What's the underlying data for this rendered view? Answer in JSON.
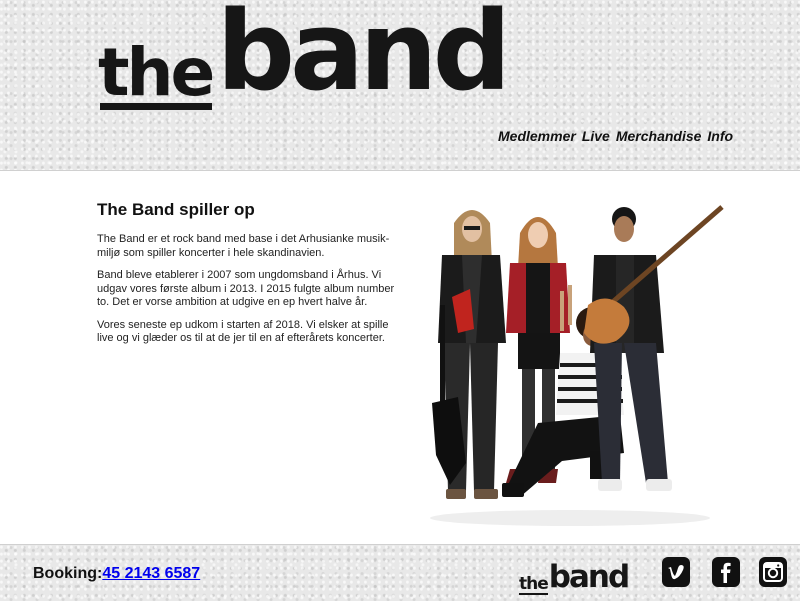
{
  "header": {
    "logo": {
      "the": "the",
      "band": "band"
    },
    "nav": [
      "Medlemmer",
      "Live",
      "Merchandise",
      "Info"
    ]
  },
  "main": {
    "heading": "The Band spiller op",
    "paragraphs": [
      "The Band er et rock band med base i det Arhusianke musik-miljø som spiller koncerter i hele skandinavien.",
      "Band bleve etablerer i 2007 som ungdomsband i Århus. Vi udgav vores første album i 2013. I 2015 fulgte album number to. Det er vorse ambition at udgive en ep hvert halve år.",
      "Vores seneste ep udkom i starten af 2018. Vi elsker at spille live og vi glæder os til at de jer til en af efterårets koncerter."
    ]
  },
  "footer": {
    "booking_label": "Booking:",
    "booking_number": "45 2143 6587",
    "logo": {
      "the": "the",
      "band": "band"
    },
    "social": [
      {
        "name": "vimeo",
        "icon": "vimeo-icon"
      },
      {
        "name": "facebook",
        "icon": "facebook-icon"
      },
      {
        "name": "instagram",
        "icon": "instagram-icon"
      }
    ]
  },
  "colors": {
    "texture": "#e8e8e8",
    "logo": "#161616",
    "link": "#0000ee",
    "text": "#222222"
  }
}
